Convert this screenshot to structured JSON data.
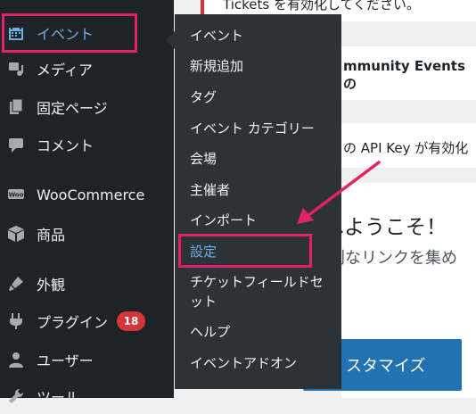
{
  "sidebar": {
    "items": [
      {
        "label": "イベント",
        "icon": "calendar-icon",
        "active": true
      },
      {
        "label": "メディア",
        "icon": "media-icon"
      },
      {
        "label": "固定ページ",
        "icon": "pages-icon"
      },
      {
        "label": "コメント",
        "icon": "comment-icon"
      },
      {
        "label": "WooCommerce",
        "icon": "woo-icon"
      },
      {
        "label": "商品",
        "icon": "box-icon"
      },
      {
        "label": "外観",
        "icon": "brush-icon"
      },
      {
        "label": "プラグイン",
        "icon": "plugin-icon",
        "badge": "18"
      },
      {
        "label": "ユーザー",
        "icon": "user-icon"
      },
      {
        "label": "ツール",
        "icon": "wrench-icon"
      }
    ]
  },
  "flyout": {
    "items": [
      {
        "label": "イベント"
      },
      {
        "label": "新規追加"
      },
      {
        "label": "タグ"
      },
      {
        "label": "イベント カテゴリー"
      },
      {
        "label": "会場"
      },
      {
        "label": "主催者"
      },
      {
        "label": "インポート"
      },
      {
        "label": "設定",
        "current": true
      },
      {
        "label": "チケットフィールドセ"
      },
      {
        "label": "ット"
      },
      {
        "label": "ヘルプ"
      },
      {
        "label": "イベントアドオン"
      }
    ]
  },
  "content": {
    "notice1": "Tickets を有効化してください。",
    "notice2": "mmunity Eventsの",
    "notice3": "の API Key が有効化",
    "welcome_title": "へようこそ！",
    "welcome_sub": "利なリンクを集め",
    "customize_button": "スタマイズ"
  },
  "colors": {
    "sidebar_bg": "#1d2327",
    "flyout_bg": "#2c3338",
    "active_text": "#72aee6",
    "highlight": "#e5206b",
    "badge": "#d63638",
    "button": "#2271b1"
  }
}
